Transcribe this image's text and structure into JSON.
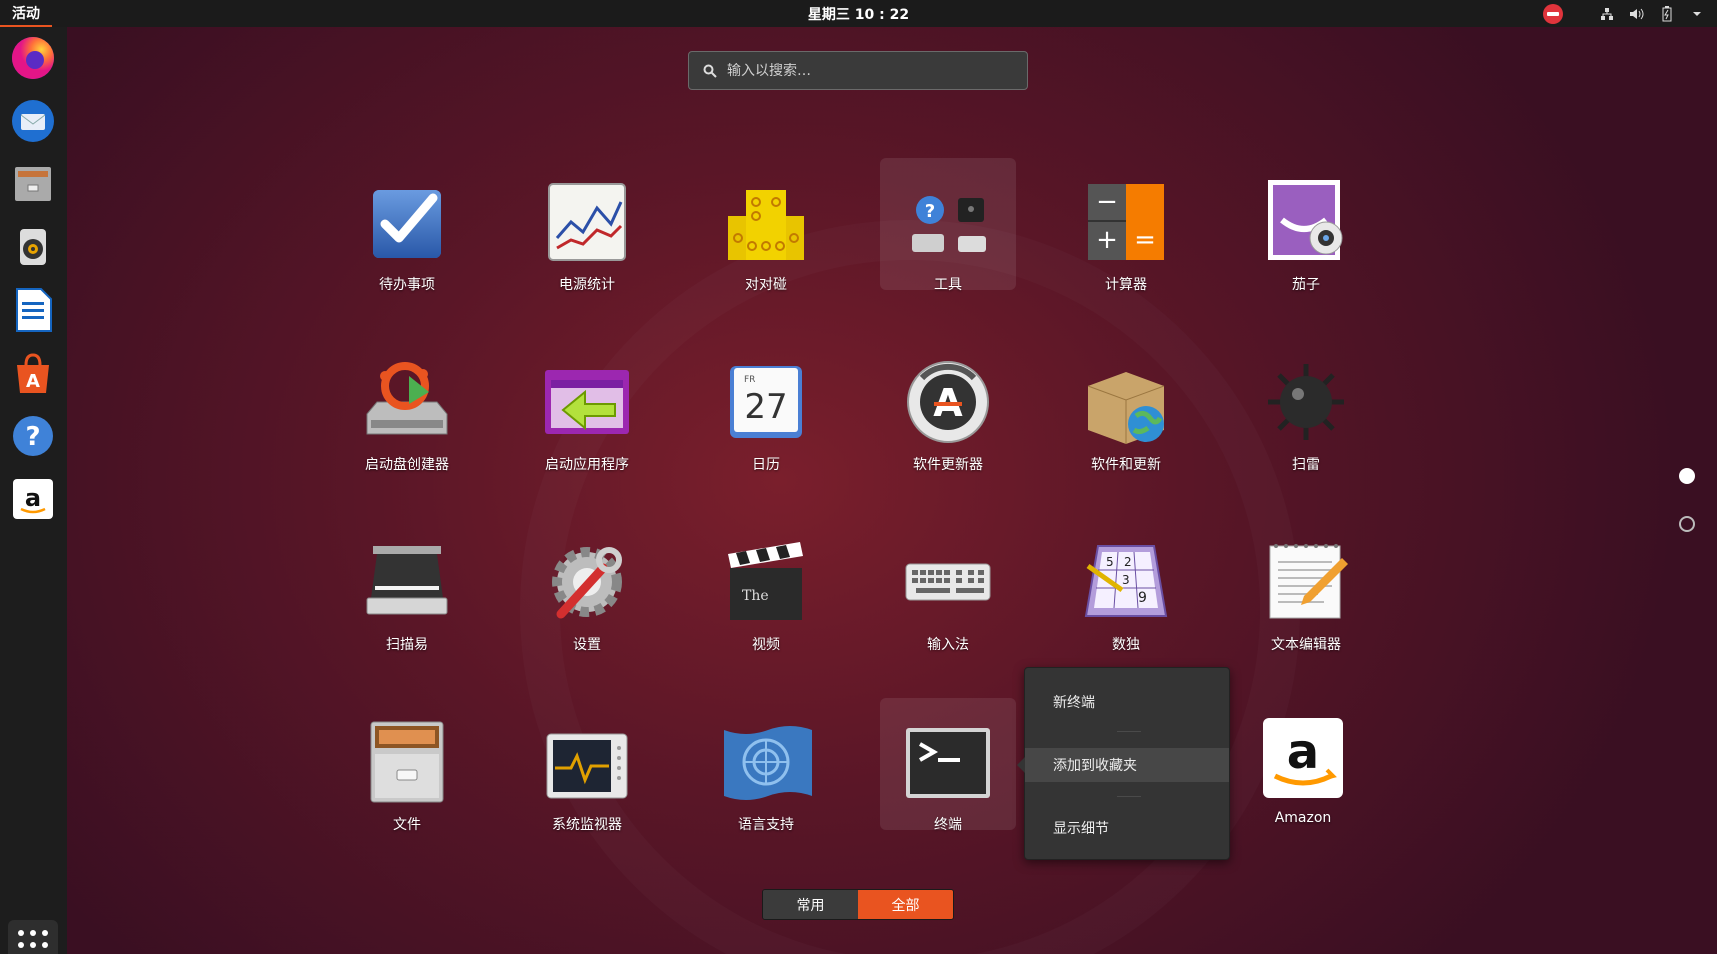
{
  "topbar": {
    "activities": "活动",
    "clock": "星期三 10 : 22"
  },
  "search": {
    "placeholder": "输入以搜索…"
  },
  "apps": [
    {
      "label": "待办事项",
      "icon": "todo-icon"
    },
    {
      "label": "电源统计",
      "icon": "power-statistics-icon"
    },
    {
      "label": "对对碰",
      "icon": "swell-foop-icon"
    },
    {
      "label": "工具",
      "icon": "utilities-folder-icon"
    },
    {
      "label": "计算器",
      "icon": "calculator-icon"
    },
    {
      "label": "茄子",
      "icon": "cheese-icon"
    },
    {
      "label": "启动盘创建器",
      "icon": "startup-disk-creator-icon"
    },
    {
      "label": "启动应用程序",
      "icon": "startup-applications-icon"
    },
    {
      "label": "日历",
      "icon": "calendar-icon"
    },
    {
      "label": "软件更新器",
      "icon": "software-updater-icon"
    },
    {
      "label": "软件和更新",
      "icon": "software-properties-icon"
    },
    {
      "label": "扫雷",
      "icon": "mines-icon"
    },
    {
      "label": "扫描易",
      "icon": "simple-scan-icon"
    },
    {
      "label": "设置",
      "icon": "settings-icon"
    },
    {
      "label": "视频",
      "icon": "videos-icon"
    },
    {
      "label": "输入法",
      "icon": "input-method-icon"
    },
    {
      "label": "数独",
      "icon": "sudoku-icon"
    },
    {
      "label": "文本编辑器",
      "icon": "text-editor-icon"
    },
    {
      "label": "文件",
      "icon": "files-icon"
    },
    {
      "label": "系统监视器",
      "icon": "system-monitor-icon"
    },
    {
      "label": "语言支持",
      "icon": "language-support-icon"
    },
    {
      "label": "终端",
      "icon": "terminal-icon"
    },
    {
      "label": "Amazon",
      "icon": "amazon-icon"
    }
  ],
  "calendar_icon": {
    "day": "FR",
    "date": "27"
  },
  "sudoku_digits": [
    "5",
    "2",
    "3",
    "9"
  ],
  "context_menu": {
    "items": [
      "新终端",
      "添加到收藏夹",
      "显示细节"
    ],
    "active_index": 1
  },
  "switcher": {
    "frequent": "常用",
    "all": "全部",
    "selected": "all"
  },
  "dock": [
    "firefox-icon",
    "thunderbird-icon",
    "file-cabinet-icon",
    "rhythmbox-icon",
    "libreoffice-writer-icon",
    "ubuntu-software-icon",
    "help-icon",
    "amazon-icon"
  ],
  "colors": {
    "accent": "#e95420",
    "topbar": "#1b1b1b",
    "dock": "#1d1d1d",
    "menu": "#343434"
  }
}
